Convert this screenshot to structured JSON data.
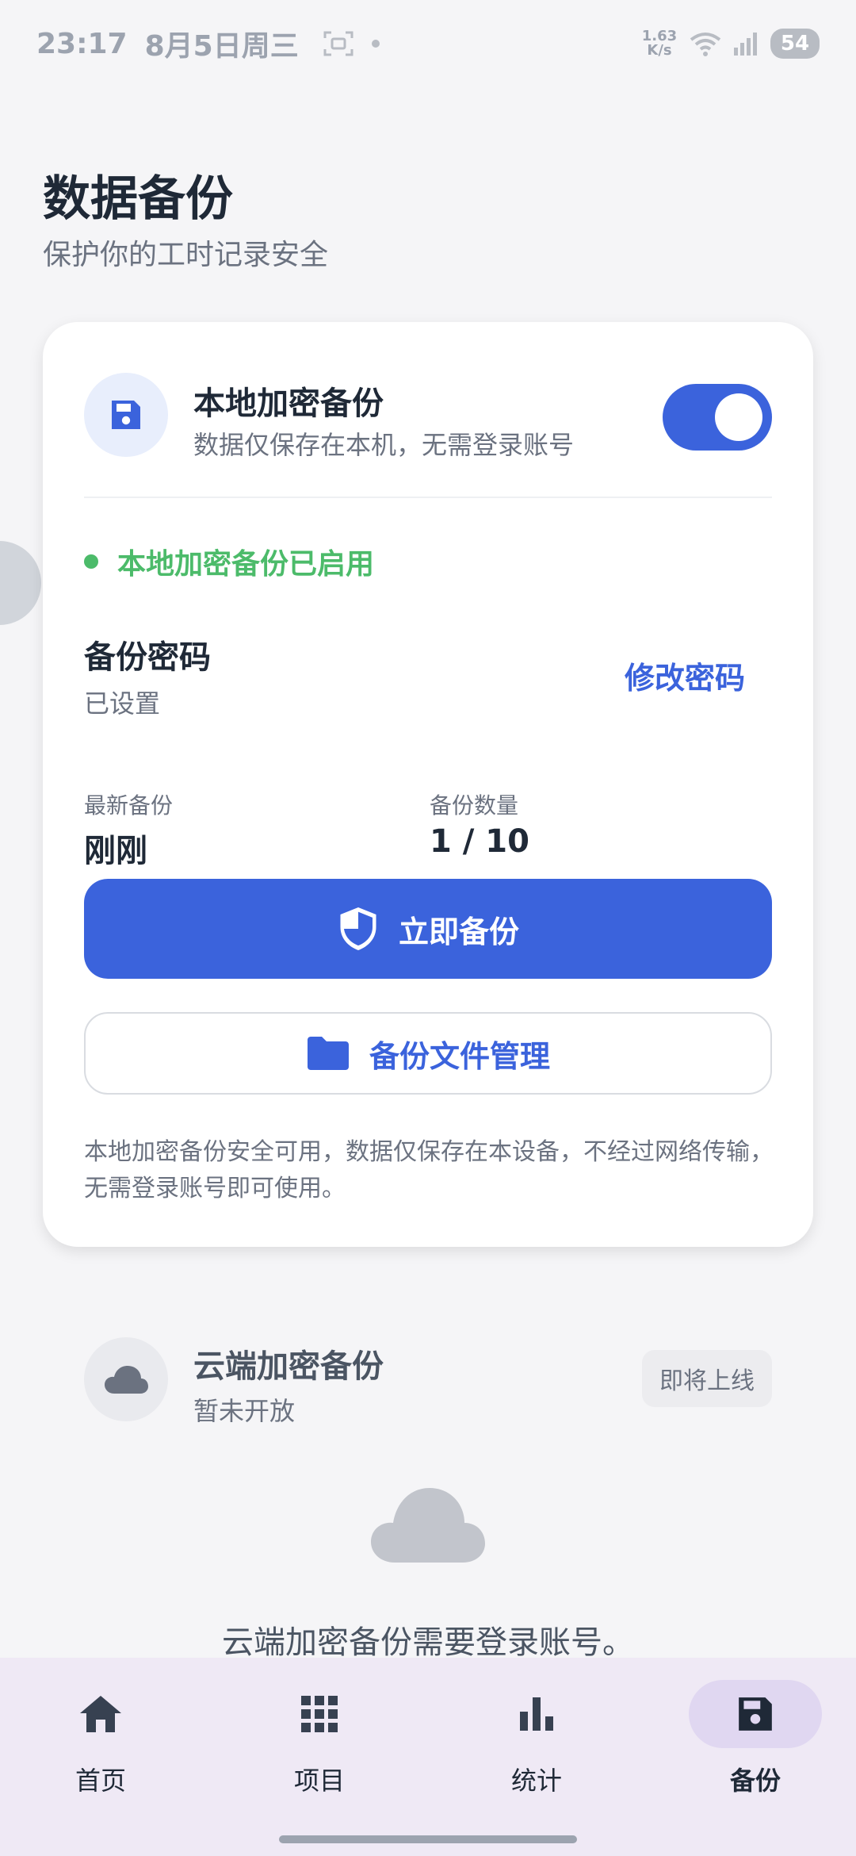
{
  "status_bar": {
    "time": "23:17",
    "date": "8月5日周三",
    "net_speed_value": "1.63",
    "net_speed_unit": "K/s",
    "battery": "54"
  },
  "header": {
    "title": "数据备份",
    "subtitle": "保护你的工时记录安全"
  },
  "local_backup": {
    "title": "本地加密备份",
    "description": "数据仅保存在本机，无需登录账号",
    "enabled": true,
    "status_text": "本地加密备份已启用",
    "password_label": "备份密码",
    "password_value": "已设置",
    "change_password": "修改密码",
    "latest_label": "最新备份",
    "latest_value": "刚刚",
    "count_label": "备份数量",
    "count_value": "1 / 10",
    "backup_now": "立即备份",
    "manage_files": "备份文件管理",
    "note": "本地加密备份安全可用，数据仅保存在本设备，不经过网络传输，无需登录账号即可使用。"
  },
  "cloud_backup": {
    "title": "云端加密备份",
    "status": "暂未开放",
    "badge": "即将上线",
    "login_note": "云端加密备份需要登录账号。"
  },
  "bottom_nav": {
    "items": [
      {
        "label": "首页",
        "icon": "home-icon"
      },
      {
        "label": "项目",
        "icon": "grid-icon"
      },
      {
        "label": "统计",
        "icon": "bar-chart-icon"
      },
      {
        "label": "备份",
        "icon": "save-icon",
        "active": true
      }
    ]
  },
  "colors": {
    "accent": "#3b63dc",
    "success": "#4cbb6a",
    "nav_background": "#efe9f5",
    "nav_active": "#e0d7f1"
  }
}
